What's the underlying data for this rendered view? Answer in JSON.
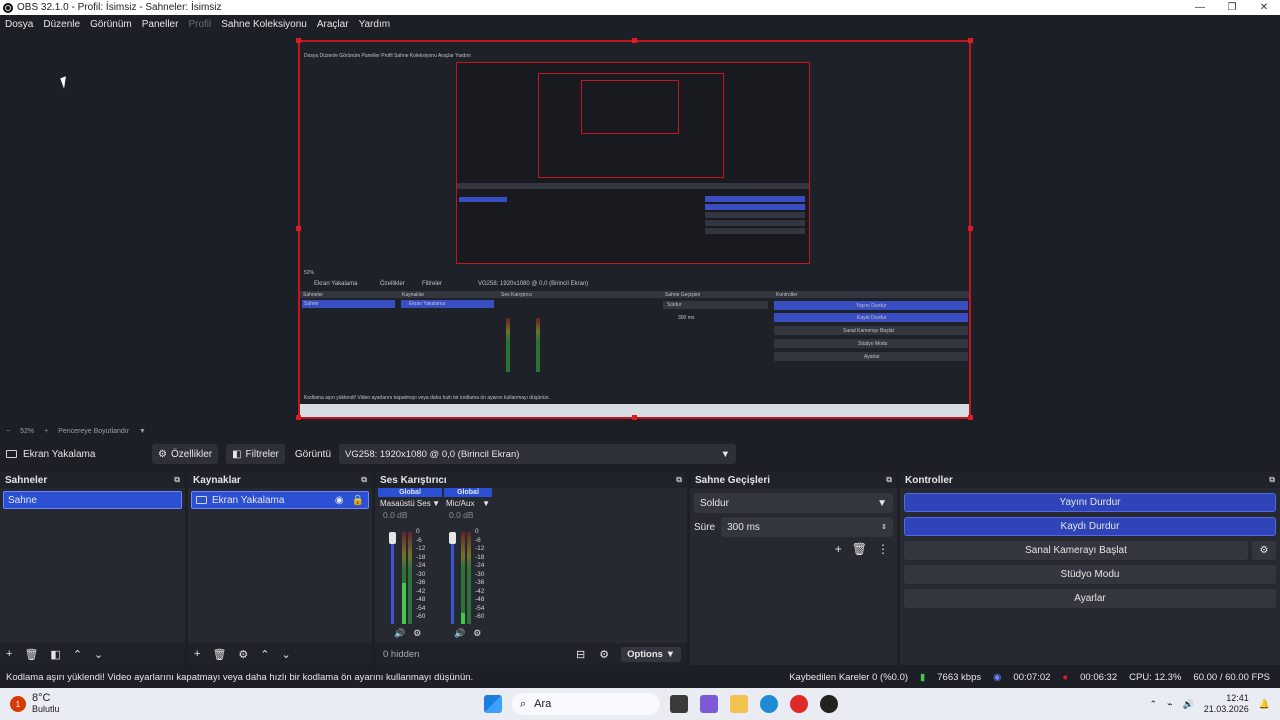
{
  "window": {
    "title": "OBS 32.1.0 - Profil: İsimsiz - Sahneler: İsimsiz",
    "minimize": "—",
    "maximize": "❐",
    "close": "✕"
  },
  "menu": [
    "Dosya",
    "Düzenle",
    "Görünüm",
    "Paneller",
    "Profil",
    "Sahne Koleksiyonu",
    "Araçlar",
    "Yardım"
  ],
  "preview": {
    "zoom": "52%",
    "fit": "Pencereye Boyutlandır",
    "nested_menu": "Dosya  Düzenle  Görünüm  Paneller  Profil  Sahne Koleksiyonu  Araçlar  Yardım",
    "nested_source": "Ekran Yakalama",
    "nested_props": "Özellikler",
    "nested_filters": "Filtreler",
    "nested_display": "VG258: 1920x1080 @ 0,0 (Birincil Ekran)",
    "nested_scenes": "Sahneler",
    "nested_sources": "Kaynaklar",
    "nested_mixer": "Ses Karıştırıcı",
    "nested_transitions": "Sahne Geçişleri",
    "nested_controls": "Kontroller",
    "nested_scene": "Sahne",
    "nested_fade": "Soldur",
    "nested_duration": "300 ms",
    "nested_stop_stream": "Yayını Durdur",
    "nested_stop_rec": "Kaydı Durdur",
    "nested_vcam": "Sanal Kamerayı Başlat",
    "nested_studio": "Stüdyo Modu",
    "nested_settings": "Ayarlar",
    "nested_status": "Kodlama aşırı yüklendi! Video ayarlarını kapatmayı veya daha hızlı bir kodlama ön ayarını kullanmayı düşünün."
  },
  "source_toolbar": {
    "source_name": "Ekran Yakalama",
    "properties": "Özellikler",
    "filters": "Filtreler",
    "display_label": "Görüntü",
    "display_value": "VG258: 1920x1080 @ 0,0 (Birincil Ekran)"
  },
  "scenes": {
    "title": "Sahneler",
    "items": [
      "Sahne"
    ]
  },
  "sources": {
    "title": "Kaynaklar",
    "items": [
      "Ekran Yakalama"
    ]
  },
  "mixer": {
    "title": "Ses Karıştırıcı",
    "channels": [
      {
        "tag": "Global",
        "name": "Masaüstü Ses",
        "db": "0.0 dB",
        "level": 0.45
      },
      {
        "tag": "Global",
        "name": "Mic/Aux",
        "db": "0.0 dB",
        "level": 0.12
      }
    ],
    "ticks": [
      "0",
      "-6",
      "-12",
      "-18",
      "-24",
      "-30",
      "-36",
      "-42",
      "-48",
      "-54",
      "-60"
    ],
    "hidden": "0 hidden",
    "options": "Options"
  },
  "transitions": {
    "title": "Sahne Geçişleri",
    "selected": "Soldur",
    "duration_label": "Süre",
    "duration_value": "300 ms"
  },
  "controls": {
    "title": "Kontroller",
    "stop_stream": "Yayını Durdur",
    "stop_record": "Kaydı Durdur",
    "virtual_cam": "Sanal Kamerayı Başlat",
    "studio_mode": "Stüdyo Modu",
    "settings": "Ayarlar"
  },
  "status": {
    "warning": "Kodlama aşırı yüklendi! Video ayarlarını kapatmayı veya daha hızlı bir kodlama ön ayarını kullanmayı düşünün.",
    "dropped": "Kaybedilen Kareler 0 (%0.0)",
    "bitrate": "7663 kbps",
    "stream_time": "00:07:02",
    "rec_time": "00:06:32",
    "cpu": "CPU: 12.3%",
    "fps": "60.00 / 60.00 FPS"
  },
  "taskbar": {
    "weather_temp": "8°C",
    "weather_desc": "Bulutlu",
    "search": "Ara",
    "time": "12:41",
    "date": "21.03.2026",
    "badge": "1"
  },
  "colors": {
    "accent": "#2e44b8",
    "record_red": "#e01b24",
    "background": "#1d1f26"
  }
}
